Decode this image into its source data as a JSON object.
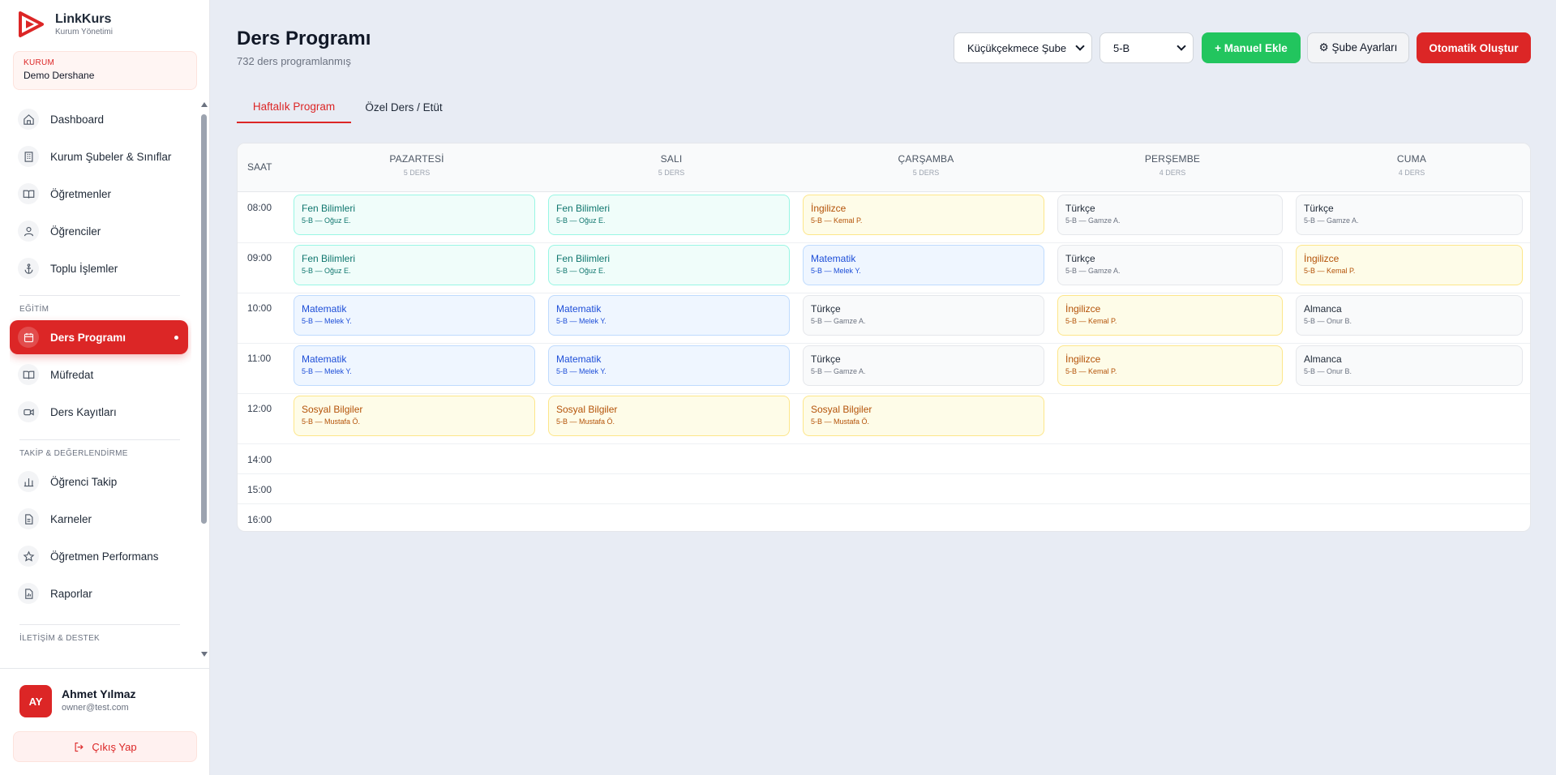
{
  "brand": {
    "name": "LinkKurs",
    "subtitle": "Kurum Yönetimi",
    "color": "#dc2626"
  },
  "org": {
    "label": "KURUM",
    "name": "Demo Dershane"
  },
  "nav": {
    "items": [
      {
        "label": "Dashboard",
        "icon": "home-icon"
      },
      {
        "label": "Kurum Şubeler & Sınıflar",
        "icon": "building-icon"
      },
      {
        "label": "Öğretmenler",
        "icon": "book-open-icon"
      },
      {
        "label": "Öğrenciler",
        "icon": "users-icon"
      },
      {
        "label": "Toplu İşlemler",
        "icon": "anchor-icon"
      }
    ],
    "section_egitim": "EĞİTİM",
    "egitim_items": [
      {
        "label": "Ders Programı",
        "icon": "calendar-icon",
        "active": true
      },
      {
        "label": "Müfredat",
        "icon": "book-open-icon"
      },
      {
        "label": "Ders Kayıtları",
        "icon": "video-icon"
      }
    ],
    "section_takip": "TAKİP & DEĞERLENDİRME",
    "takip_items": [
      {
        "label": "Öğrenci Takip",
        "icon": "bar-chart-icon"
      },
      {
        "label": "Karneler",
        "icon": "file-text-icon"
      },
      {
        "label": "Öğretmen Performans",
        "icon": "star-icon"
      },
      {
        "label": "Raporlar",
        "icon": "report-icon"
      }
    ],
    "section_iletisim": "İLETİŞİM & DESTEK"
  },
  "user": {
    "initials": "AY",
    "name": "Ahmet Yılmaz",
    "email": "owner@test.com",
    "logout_label": "Çıkış Yap"
  },
  "header": {
    "title": "Ders Programı",
    "subtitle": "732 ders programlanmış",
    "branch_select": "Küçükçekmece Şube",
    "class_select": "5-B",
    "manual_add": "+ Manuel Ekle",
    "branch_settings": "⚙ Şube Ayarları",
    "auto_create": "Otomatik Oluştur"
  },
  "tabs": [
    {
      "label": "Haftalık Program",
      "active": true
    },
    {
      "label": "Özel Ders / Etüt",
      "active": false
    }
  ],
  "schedule": {
    "time_header": "SAAT",
    "days": [
      {
        "name": "PAZARTESİ",
        "count": "5 DERS"
      },
      {
        "name": "SALI",
        "count": "5 DERS"
      },
      {
        "name": "ÇARŞAMBA",
        "count": "5 DERS"
      },
      {
        "name": "PERŞEMBE",
        "count": "4 DERS"
      },
      {
        "name": "CUMA",
        "count": "4 DERS"
      }
    ],
    "times": [
      "08:00",
      "09:00",
      "10:00",
      "11:00",
      "12:00",
      "14:00",
      "15:00",
      "16:00"
    ],
    "slots": [
      [
        {
          "subject": "Fen Bilimleri",
          "meta": "5-B — Oğuz E.",
          "color": "teal"
        },
        {
          "subject": "Fen Bilimleri",
          "meta": "5-B — Oğuz E.",
          "color": "teal"
        },
        {
          "subject": "İngilizce",
          "meta": "5-B — Kemal P.",
          "color": "yellow"
        },
        {
          "subject": "Türkçe",
          "meta": "5-B — Gamze A.",
          "color": "gray"
        },
        {
          "subject": "Türkçe",
          "meta": "5-B — Gamze A.",
          "color": "gray"
        }
      ],
      [
        {
          "subject": "Fen Bilimleri",
          "meta": "5-B — Oğuz E.",
          "color": "teal"
        },
        {
          "subject": "Fen Bilimleri",
          "meta": "5-B — Oğuz E.",
          "color": "teal"
        },
        {
          "subject": "Matematik",
          "meta": "5-B — Melek Y.",
          "color": "blue"
        },
        {
          "subject": "Türkçe",
          "meta": "5-B — Gamze A.",
          "color": "gray"
        },
        {
          "subject": "İngilizce",
          "meta": "5-B — Kemal P.",
          "color": "yellow"
        }
      ],
      [
        {
          "subject": "Matematik",
          "meta": "5-B — Melek Y.",
          "color": "blue"
        },
        {
          "subject": "Matematik",
          "meta": "5-B — Melek Y.",
          "color": "blue"
        },
        {
          "subject": "Türkçe",
          "meta": "5-B — Gamze A.",
          "color": "gray"
        },
        {
          "subject": "İngilizce",
          "meta": "5-B — Kemal P.",
          "color": "yellow"
        },
        {
          "subject": "Almanca",
          "meta": "5-B — Onur B.",
          "color": "gray"
        }
      ],
      [
        {
          "subject": "Matematik",
          "meta": "5-B — Melek Y.",
          "color": "blue"
        },
        {
          "subject": "Matematik",
          "meta": "5-B — Melek Y.",
          "color": "blue"
        },
        {
          "subject": "Türkçe",
          "meta": "5-B — Gamze A.",
          "color": "gray"
        },
        {
          "subject": "İngilizce",
          "meta": "5-B — Kemal P.",
          "color": "yellow"
        },
        {
          "subject": "Almanca",
          "meta": "5-B — Onur B.",
          "color": "gray"
        }
      ],
      [
        {
          "subject": "Sosyal Bilgiler",
          "meta": "5-B — Mustafa Ö.",
          "color": "yellow"
        },
        {
          "subject": "Sosyal Bilgiler",
          "meta": "5-B — Mustafa Ö.",
          "color": "yellow"
        },
        {
          "subject": "Sosyal Bilgiler",
          "meta": "5-B — Mustafa Ö.",
          "color": "yellow"
        },
        null,
        null
      ]
    ]
  }
}
